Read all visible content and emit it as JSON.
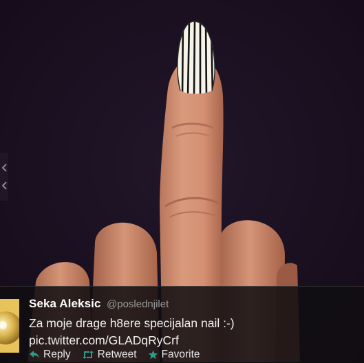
{
  "tweet": {
    "author": {
      "display_name": "Seka Aleksic",
      "handle": "@poslednjilet",
      "avatar_icon": "avatar-image"
    },
    "text": "Za moje drage h8ere specijalan nail :-)",
    "media_link": "pic.twitter.com/GLADqRyCrf"
  },
  "actions": {
    "reply_label": "Reply",
    "retweet_label": "Retweet",
    "favorite_label": "Favorite"
  },
  "colors": {
    "background": "#170d1d",
    "action_icon": "#2b9c8c",
    "caption_bg": "#100e12"
  }
}
